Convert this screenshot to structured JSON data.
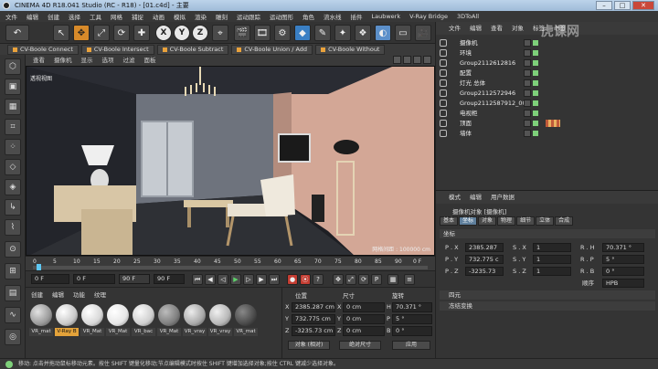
{
  "window": {
    "title": "CINEMA 4D R18.041 Studio (RC - R18) - [01.c4d] - 主要"
  },
  "menubar": [
    "文件",
    "编辑",
    "创建",
    "选择",
    "工具",
    "网格",
    "捕捉",
    "动画",
    "模拟",
    "渲染",
    "雕刻",
    "运动跟踪",
    "运动图形",
    "角色",
    "流水线",
    "插件",
    "Laubwerk",
    "V-Ray Bridge",
    "3DToAll"
  ],
  "toolbar": {
    "axes": [
      "X",
      "Y",
      "Z"
    ]
  },
  "boole_tabs": [
    "CV-Boole Connect",
    "CV-Boole Intersect",
    "CV-Boole Subtract",
    "CV-Boole Union / Add",
    "CV-Boole Without"
  ],
  "viewport": {
    "menu": [
      "查看",
      "摄像机",
      "显示",
      "选项",
      "过滤",
      "面板"
    ],
    "label": "透视视图",
    "grid_distance": "网格间距 : 100000 cm"
  },
  "timeline": {
    "ticks": [
      "0",
      "5",
      "10",
      "15",
      "20",
      "25",
      "30",
      "35",
      "40",
      "45",
      "50",
      "55",
      "60",
      "65",
      "70",
      "75",
      "80",
      "85",
      "90"
    ],
    "end_frame": "0 F"
  },
  "transport": {
    "current": "0 F",
    "start": "0 F",
    "end": "90 F",
    "max": "90 F"
  },
  "materials": {
    "menu": [
      "创建",
      "编辑",
      "功能",
      "纹理"
    ],
    "items": [
      {
        "label": "VR_mat",
        "color": "#9a9a9a"
      },
      {
        "label": "V-Ray B",
        "color": "#c9c9c9",
        "selected": true
      },
      {
        "label": "VR_Mat",
        "color": "#d8d8d8"
      },
      {
        "label": "VR_Mat",
        "color": "#e6e6e6"
      },
      {
        "label": "VR_bac",
        "color": "#cfcfcf"
      },
      {
        "label": "VR_Mat",
        "color": "#7e7e7e"
      },
      {
        "label": "VR_vray",
        "color": "#a9a9a9"
      },
      {
        "label": "VR_vray",
        "color": "#b7b7b7"
      },
      {
        "label": "VR_mat",
        "color": "#4a4a4a"
      }
    ]
  },
  "coordinates": {
    "headers": [
      "位置",
      "尺寸",
      "旋转"
    ],
    "position": [
      {
        "axis": "X",
        "value": "2385.287 cm"
      },
      {
        "axis": "Y",
        "value": "732.775 cm"
      },
      {
        "axis": "Z",
        "value": "-3235.73 cm"
      }
    ],
    "size": [
      {
        "axis": "X",
        "value": "0 cm"
      },
      {
        "axis": "Y",
        "value": "0 cm"
      },
      {
        "axis": "Z",
        "value": "0 cm"
      }
    ],
    "rotation": [
      {
        "axis": "H",
        "value": "70.371 °"
      },
      {
        "axis": "P",
        "value": "5 °"
      },
      {
        "axis": "B",
        "value": "0 °"
      }
    ],
    "mode_object": "对象 (相对)",
    "mode_size": "绝对尺寸",
    "apply": "应用"
  },
  "object_manager": {
    "menu": [
      "文件",
      "编辑",
      "查看",
      "对象",
      "标签",
      "书签"
    ],
    "rows": [
      "摄像机",
      "环境",
      "Group2112612816",
      "配置",
      "灯光 总体",
      "Group2112572946",
      "Group2112587912_001",
      "电视柜",
      "顶面",
      "墙体"
    ]
  },
  "attributes": {
    "menu": [
      "模式",
      "编辑",
      "用户数据"
    ],
    "title": "摄像机对象 [摄像机]",
    "tabs": [
      "基本",
      "坐标",
      "对象",
      "物理",
      "细节",
      "立体",
      "合成"
    ],
    "section": "坐标",
    "fields": [
      {
        "label": "P . X",
        "value": "2385.287"
      },
      {
        "label": "P . Y",
        "value": "732.775 c"
      },
      {
        "label": "P . Z",
        "value": "-3235.73"
      }
    ],
    "scale": [
      {
        "label": "S . X",
        "value": "1"
      },
      {
        "label": "S . Y",
        "value": "1"
      },
      {
        "label": "S . Z",
        "value": "1"
      }
    ],
    "rot": [
      {
        "label": "R . H",
        "value": "70.371 °"
      },
      {
        "label": "R . P",
        "value": "5 °"
      },
      {
        "label": "R . B",
        "value": "0 °"
      }
    ],
    "order_label": "顺序",
    "order_value": "HPB",
    "fold1": "四元",
    "fold2": "冻结变换"
  },
  "status": "移动: 点击并拖动鼠标移动元素。按住 SHIFT 键量化移动;节点编辑模式时按住 SHIFT 键增加选择对象;按住 CTRL 键减少选择对象。",
  "watermark": "虎课网"
}
